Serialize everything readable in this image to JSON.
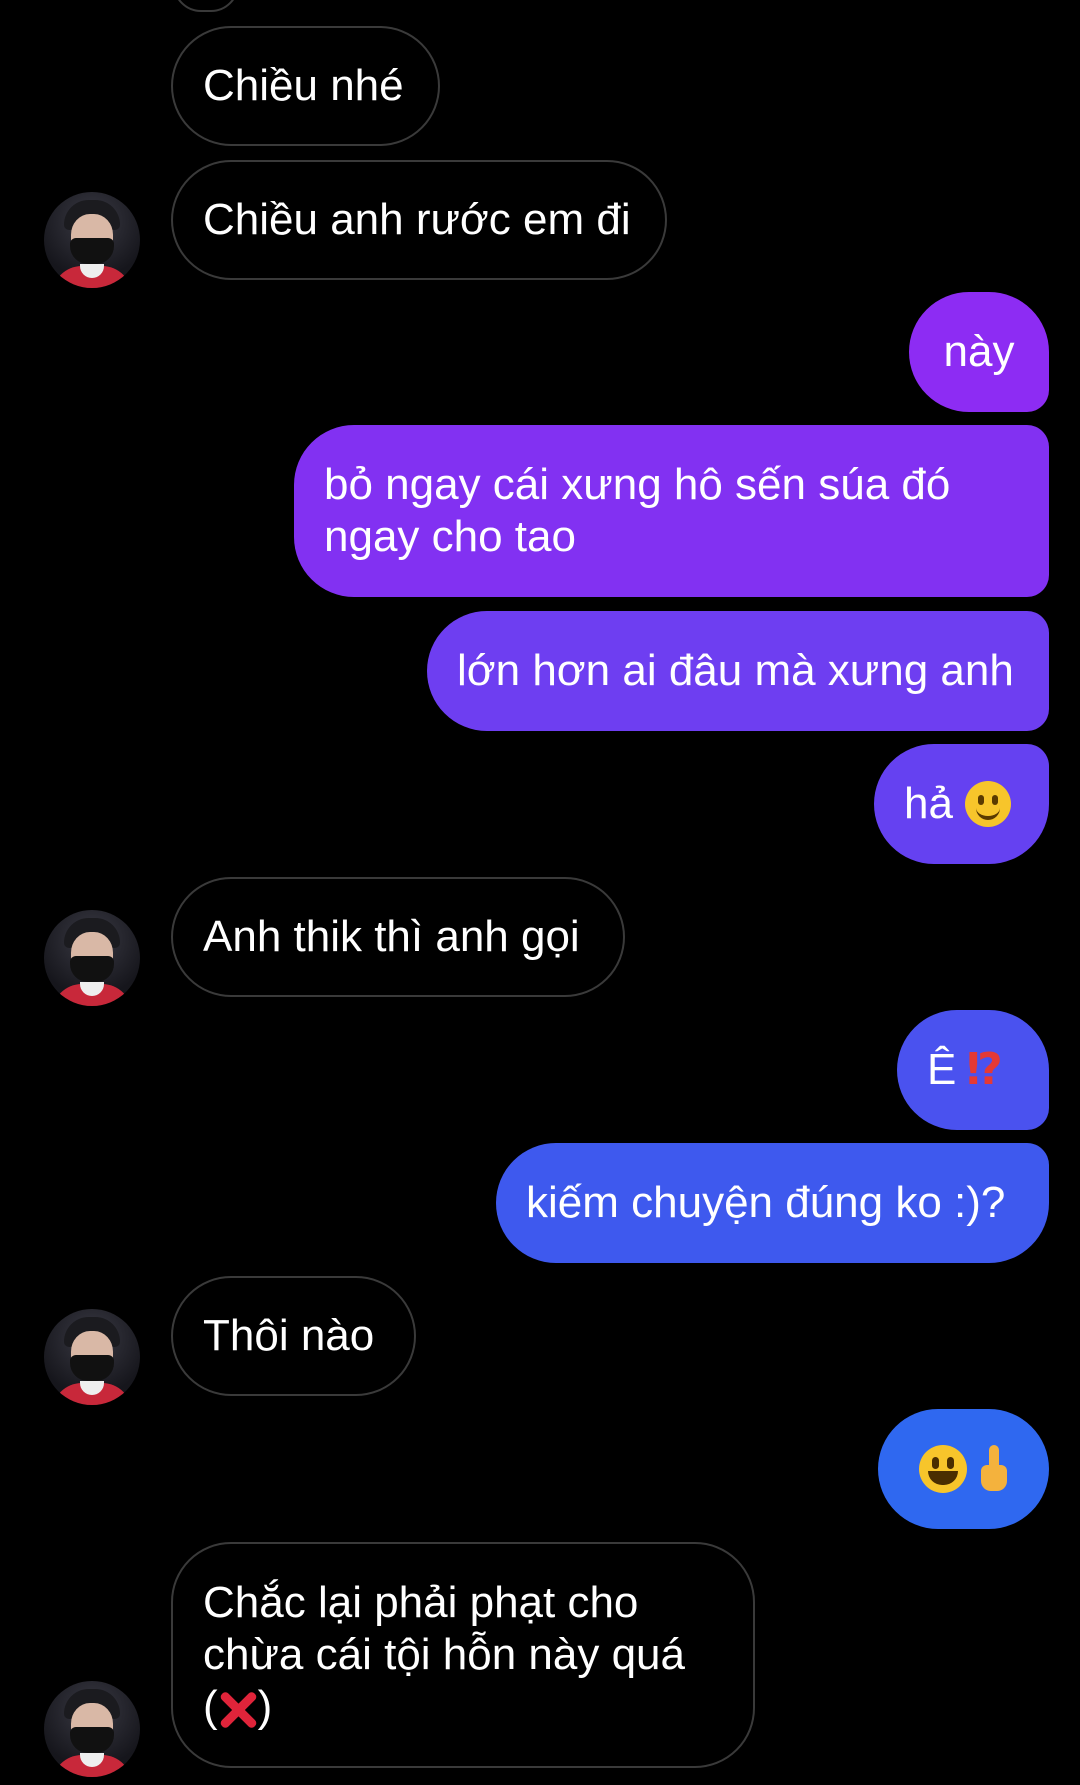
{
  "messages": [
    {
      "side": "in",
      "text": "Chiều nhé"
    },
    {
      "side": "in",
      "text": "Chiều anh rước em đi"
    },
    {
      "side": "out",
      "text": "này"
    },
    {
      "side": "out",
      "text": "bỏ ngay cái xưng hô sến súa đó\nngay cho tao"
    },
    {
      "side": "out",
      "text": "lớn hơn ai đâu mà xưng anh"
    },
    {
      "side": "out",
      "text": "hả",
      "emoji": "slightly-smiling-face-icon"
    },
    {
      "side": "in",
      "text": "Anh thik thì anh gọi"
    },
    {
      "side": "out",
      "text": "Ê",
      "trailing": "⁉"
    },
    {
      "side": "out",
      "text": "kiếm chuyện đúng ko :)?"
    },
    {
      "side": "in",
      "text": "Thôi nào"
    },
    {
      "side": "out",
      "text": "",
      "emoji": [
        "grinning-face-icon",
        "middle-finger-icon"
      ]
    },
    {
      "side": "in",
      "text": "Chắc lại phải phạt cho\nchừa cái tội hỗn này quá\n(",
      "trailing_text": ")",
      "emoji": "cross-mark-icon"
    }
  ],
  "colors": {
    "background": "#000000",
    "incoming_border": "#3a3a3a",
    "outgoing_gradient": [
      "#8b2cf2",
      "#7a3df0",
      "#5b4cf0",
      "#3a5df0",
      "#2f6ff2"
    ]
  }
}
